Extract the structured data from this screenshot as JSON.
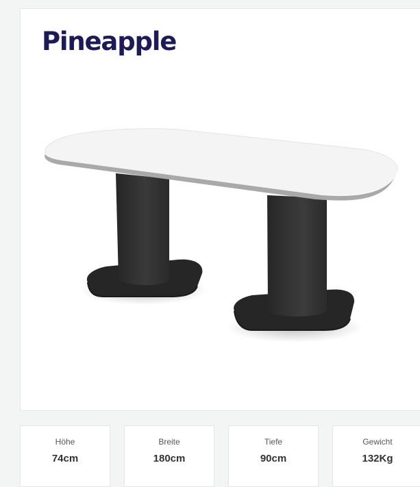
{
  "product": {
    "title": "Pineapple",
    "image_icon": "oval-conference-table-illustration"
  },
  "specs": [
    {
      "label": "Höhe",
      "value": "74cm"
    },
    {
      "label": "Breite",
      "value": "180cm"
    },
    {
      "label": "Tiefe",
      "value": "90cm"
    },
    {
      "label": "Gewicht",
      "value": "132Kg"
    }
  ],
  "colors": {
    "title": "#1c1a57",
    "table_top": "#f4f4f4",
    "table_edge": "#a9a9a9",
    "table_base": "#333333",
    "page_background": "#f3f4f4"
  }
}
